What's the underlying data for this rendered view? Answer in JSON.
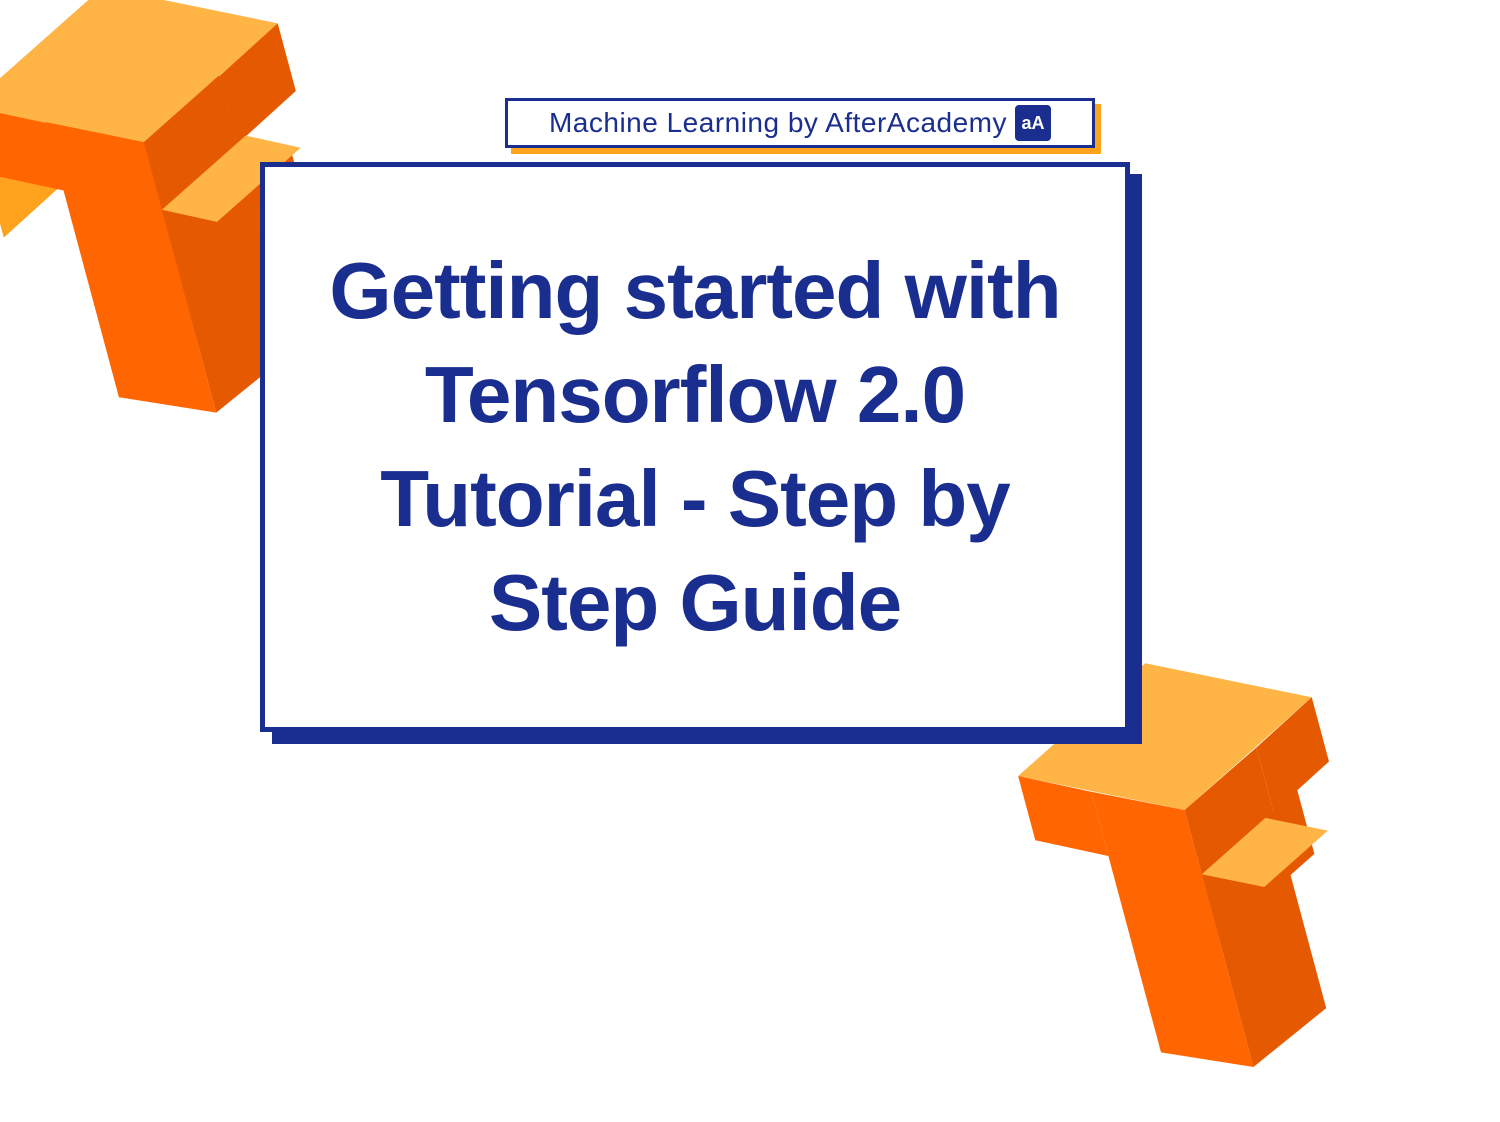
{
  "badge": {
    "text": "Machine Learning by AfterAcademy",
    "icon_label": "aA"
  },
  "title": "Getting started with Tensorflow 2.0 Tutorial - Step by Step Guide",
  "colors": {
    "primary_blue": "#1A2E8F",
    "accent_orange": "#FFA21E",
    "tf_orange_light": "#FFA21E",
    "tf_orange_dark": "#FF6500"
  }
}
